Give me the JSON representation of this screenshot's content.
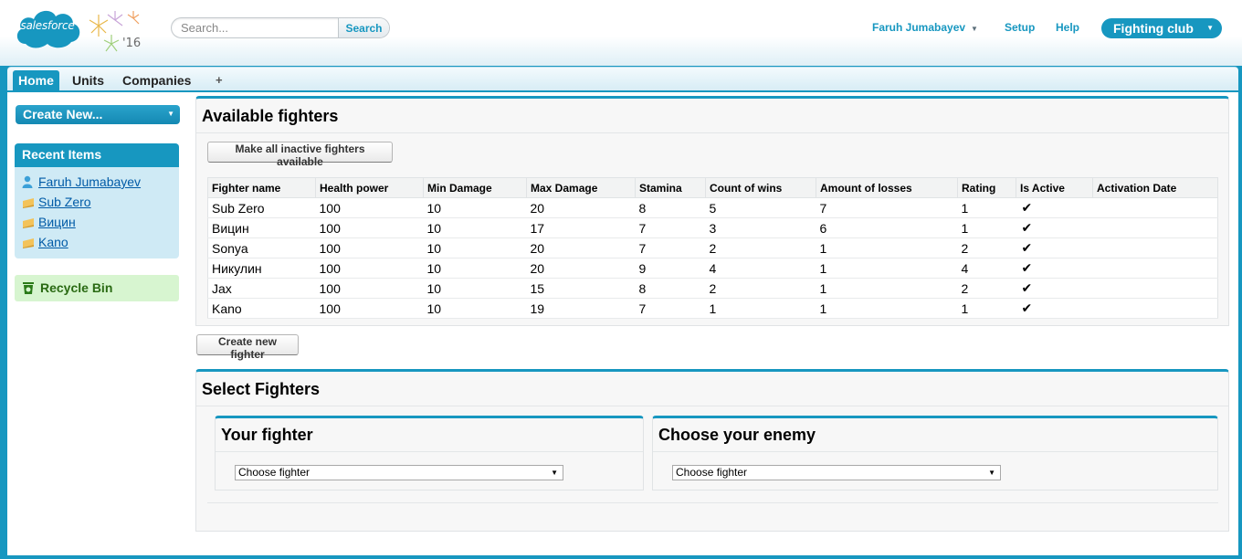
{
  "header": {
    "logo_text": "salesforce",
    "release_year": "'16",
    "search": {
      "placeholder": "Search...",
      "button_label": "Search"
    },
    "user_name": "Faruh Jumabayev",
    "setup_label": "Setup",
    "help_label": "Help",
    "app_name": "Fighting club"
  },
  "tabs": [
    {
      "label": "Home",
      "active": true
    },
    {
      "label": "Units",
      "active": false
    },
    {
      "label": "Companies",
      "active": false
    },
    {
      "label": "+",
      "active": false
    }
  ],
  "sidebar": {
    "create_new_label": "Create New...",
    "recent_items_title": "Recent Items",
    "recent_items": [
      {
        "label": "Faruh Jumabayev",
        "icon": "user-icon"
      },
      {
        "label": "Sub Zero",
        "icon": "record-icon"
      },
      {
        "label": "Вицин",
        "icon": "record-icon"
      },
      {
        "label": "Kano",
        "icon": "record-icon"
      }
    ],
    "recycle_bin_label": "Recycle Bin"
  },
  "fighters_panel": {
    "title": "Available fighters",
    "activate_button_label": "Make all inactive fighters available",
    "columns": [
      "Fighter name",
      "Health power",
      "Min Damage",
      "Max Damage",
      "Stamina",
      "Count of wins",
      "Amount of losses",
      "Rating",
      "Is Active",
      "Activation Date"
    ],
    "rows": [
      {
        "name": "Sub Zero",
        "health": "100",
        "min_damage": "10",
        "max_damage": "20",
        "stamina": "8",
        "wins": "5",
        "losses": "7",
        "rating": "1",
        "active": "✔",
        "activation_date": ""
      },
      {
        "name": "Вицин",
        "health": "100",
        "min_damage": "10",
        "max_damage": "17",
        "stamina": "7",
        "wins": "3",
        "losses": "6",
        "rating": "1",
        "active": "✔",
        "activation_date": ""
      },
      {
        "name": "Sonya",
        "health": "100",
        "min_damage": "10",
        "max_damage": "20",
        "stamina": "7",
        "wins": "2",
        "losses": "1",
        "rating": "2",
        "active": "✔",
        "activation_date": ""
      },
      {
        "name": "Никулин",
        "health": "100",
        "min_damage": "10",
        "max_damage": "20",
        "stamina": "9",
        "wins": "4",
        "losses": "1",
        "rating": "4",
        "active": "✔",
        "activation_date": ""
      },
      {
        "name": "Jax",
        "health": "100",
        "min_damage": "10",
        "max_damage": "15",
        "stamina": "8",
        "wins": "2",
        "losses": "1",
        "rating": "2",
        "active": "✔",
        "activation_date": ""
      },
      {
        "name": "Kano",
        "health": "100",
        "min_damage": "10",
        "max_damage": "19",
        "stamina": "7",
        "wins": "1",
        "losses": "1",
        "rating": "1",
        "active": "✔",
        "activation_date": ""
      }
    ],
    "create_button_label": "Create new fighter"
  },
  "select_panel": {
    "title": "Select Fighters",
    "your_fighter": {
      "title": "Your fighter",
      "selected": "Choose fighter"
    },
    "enemy": {
      "title": "Choose your enemy",
      "selected": "Choose fighter"
    }
  },
  "colors": {
    "brand": "#1797c0",
    "link": "#015ba7",
    "recent_bg": "#cfeaf5",
    "recycle_bg": "#d7f5d0"
  }
}
